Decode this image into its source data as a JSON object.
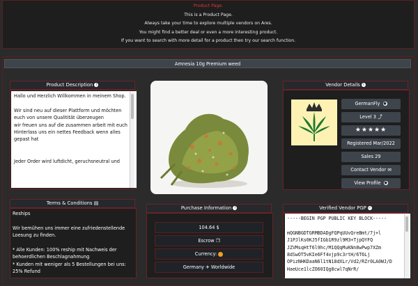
{
  "notice": {
    "title": "Product Page.",
    "line1": "This is a Product Page.",
    "line2": "Always take your time to explore multiple vendors on Ares.",
    "line3": "You might find a better deal or even a more interesting product.",
    "line4": "If you want to search with more detail for a product then try our search function."
  },
  "product": {
    "name": "Amnesia 10g Premium weed",
    "image_icon": "cannabis-bud-photo"
  },
  "description": {
    "header": "Product Description",
    "text": "Hallo und Herzlich Willkommen in meinem Shop.\n\nWir sind neu auf dieser Plattform und möchten euch von unsere Qualitität überzeugen\nwir freuen uns auf die zusammen arbeit mit euch\nHinterlass uns ein nettes Feedback wenn alles gepast hat\n\n\nJeder Order wird luftdicht, geruchsneutral und"
  },
  "terms": {
    "header": "Terms & Conditions",
    "text": "Reships\n\nWir bemühen uns immer eine zufriedenstellende Loesung zu finden.\n\n* Alle Kunden: 100% reship mit Nachweis der behoerdlichen Beschlagnahmung\n* Kunden mit weniger als 5 Bestellungen bei uns: 25% Refund"
  },
  "purchase": {
    "header": "Purchase Information",
    "price": "104.64 $",
    "escrow": "Escrow",
    "currency": "Currency:",
    "shipping_from": "Germany",
    "shipping_to": "Worldwide"
  },
  "vendor": {
    "header": "Vendor Details",
    "name": "GermanFly",
    "level": "Level 3",
    "stars": "★★★★★",
    "registered": "Registered Mar/2022",
    "sales": "Sales 29",
    "contact": "Contact Vendor",
    "profile": "View Profile",
    "logo_icon": "crowned-leaf-logo"
  },
  "pgp": {
    "header": "Verified Vendor PGP",
    "text": "-----BEGIN PGP PUBLIC KEY BLOCK-----\n\nmQGNBGDTGRMBDADgFQPqUUvQreBmt/7j+l\nJ1PJlKs0KJ5fIGb1R9zl9M3+TjpQYFQ\nJZVMsqHtT6l9hc/M1QQqMuKNn8wPwp7XZm\n8dSwOT5vKIe6Ff4vjp9c3rtH/6T6Lj\nOPizNHKDaaN6l1tN18dXLr/Vd2/RZr0LA0WJ/D\nHaeUce1lcZO60IQg8cwl7qNrR/"
  },
  "colors": {
    "background": "#2b2b2b",
    "border": "#6b2226",
    "header_bg": "#25292d",
    "accent_red": "#e03a3a"
  }
}
